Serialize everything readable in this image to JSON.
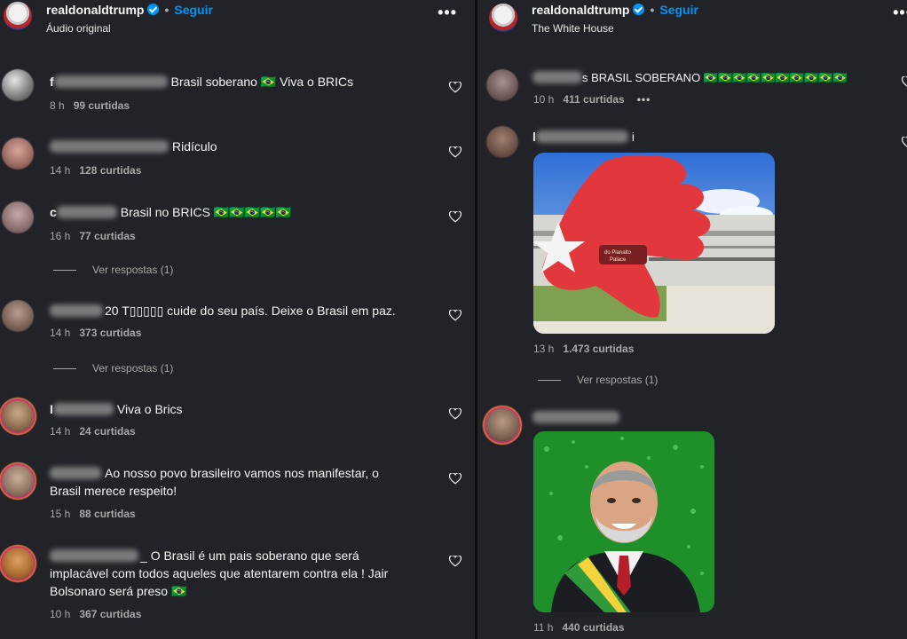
{
  "left": {
    "username": "realdonaldtrump",
    "follow_label": "Seguir",
    "subtitle": "Áudio original",
    "comments": [
      {
        "user_suffix": "",
        "text": "Brasil soberano 🇧🇷 Viva o BRICs",
        "time": "8 h",
        "likes": "99 curtidas"
      },
      {
        "user_suffix": "",
        "text": "Ridículo",
        "time": "14 h",
        "likes": "128 curtidas"
      },
      {
        "user_suffix": "",
        "text": "Brasil no BRICS 🇧🇷🇧🇷🇧🇷🇧🇷🇧🇷",
        "time": "16 h",
        "likes": "77 curtidas",
        "replies": "Ver respostas (1)"
      },
      {
        "user_suffix": "20",
        "text": "T▯▯▯▯▯ cuide do seu país. Deixe o Brasil em paz.",
        "time": "14 h",
        "likes": "373 curtidas",
        "replies": "Ver respostas (1)"
      },
      {
        "user_suffix": "",
        "text": "Viva o Brics",
        "time": "14 h",
        "likes": "24 curtidas"
      },
      {
        "user_suffix": "",
        "text_line1": "Ao nosso povo brasileiro vamos nos manifestar, o",
        "text_line2": "Brasil merece respeito!",
        "time": "15 h",
        "likes": "88 curtidas"
      },
      {
        "user_suffix": "",
        "text_line1": "O Brasil é um pais soberano que será",
        "text_line2": "implacável com todos aqueles que atentarem contra ela ! Jair",
        "text_line3": "Bolsonaro será preso 🇧🇷",
        "time": "10 h",
        "likes": "367 curtidas"
      }
    ]
  },
  "right": {
    "username": "realdonaldtrump",
    "follow_label": "Seguir",
    "subtitle": "The White House",
    "comments": [
      {
        "text": "BRASIL SOBERANO 🇧🇷🇧🇷🇧🇷🇧🇷🇧🇷🇧🇷🇧🇷🇧🇷🇧🇷🇧🇷",
        "time": "10 h",
        "likes": "411 curtidas"
      },
      {
        "text": "",
        "time": "13 h",
        "likes": "1.473 curtidas",
        "replies": "Ver respostas (1)",
        "image_sign": "do Planalto Palace"
      },
      {
        "text": "",
        "time": "11 h",
        "likes": "440 curtidas"
      }
    ]
  },
  "icons": {
    "verified": "verified-badge-icon",
    "more": "more-options-icon",
    "heart": "heart-icon"
  },
  "colors": {
    "background": "#212328",
    "accent": "#0095f6",
    "muted": "#a8a8a8"
  }
}
